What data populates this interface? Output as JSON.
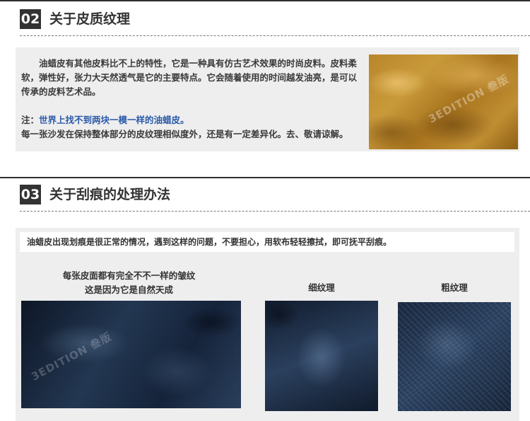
{
  "section1": {
    "number": "02",
    "title": "关于皮质纹理",
    "paragraph": "油蜡皮有其他皮料比不上的特性，它是一种具有仿古艺术效果的时尚皮料。皮料柔软，弹性好，张力大天然透气是它的主要特点。它会随着使用的时间越发油亮，是可以传承的皮料艺术品。",
    "note_label": "注：",
    "note_highlight": "世界上找不到两块一模一样的油蜡皮。",
    "note_detail": "每一张沙发在保持整体部分的皮纹理相似度外，还是有一定差异化。去、敬请谅解。",
    "image_watermark": "3EDITION 叁版"
  },
  "section2": {
    "number": "03",
    "title": "关于刮痕的处理办法",
    "banner": "油蜡皮出现划痕是很正常的情况，遇到这样的问题，不要担心，用软布轻轻擦拭，即可抚平刮痕。",
    "caption_main_line1": "每张皮面都有完全不不一样的皱纹",
    "caption_main_line2": "这是因为它是自然天成",
    "caption_fine": "细纹理",
    "caption_coarse": "粗纹理",
    "image_watermark": "3EDITION 叁版"
  },
  "colors": {
    "header_box": "#333333",
    "highlight": "#2a5aa8",
    "panel_bg": "#eeeeee"
  }
}
